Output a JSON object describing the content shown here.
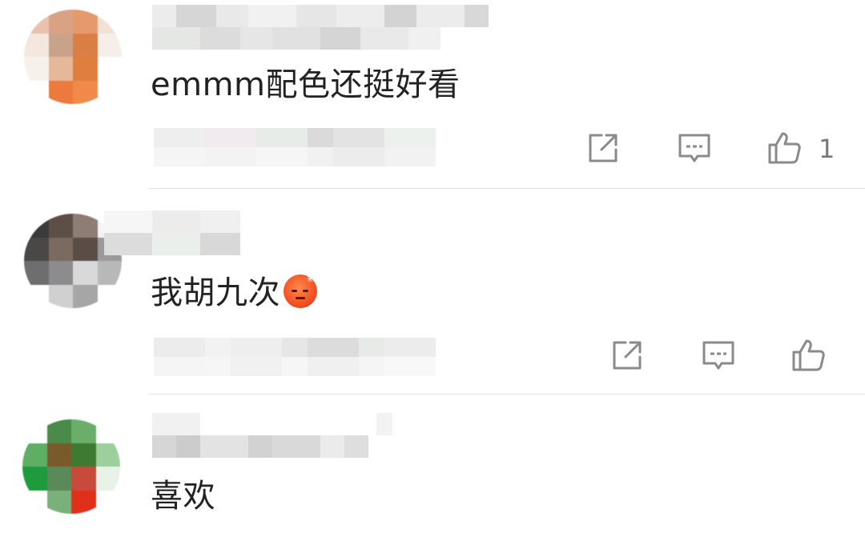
{
  "comments": [
    {
      "text": "emmm配色还挺好看",
      "like_count": "1"
    },
    {
      "text": "我胡九次",
      "emoji": "angry-face-emoji",
      "like_count": ""
    },
    {
      "text": "喜欢",
      "like_count": ""
    }
  ],
  "icons": {
    "share": "share-icon",
    "reply": "comment-icon",
    "like": "thumbs-up-icon"
  },
  "colors": {
    "text": "#222222",
    "icon": "#8a8a8a",
    "divider": "#e3e3e3"
  }
}
